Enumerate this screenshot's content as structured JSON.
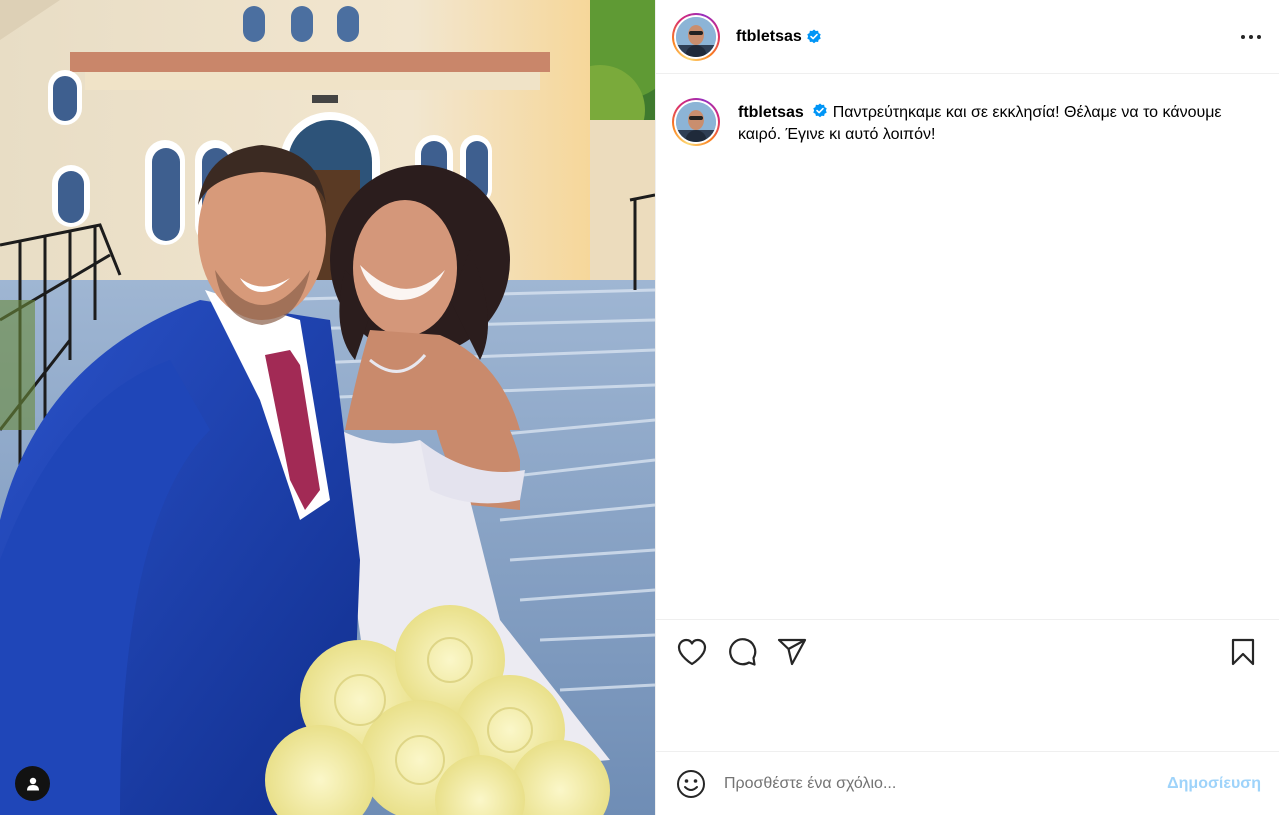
{
  "header": {
    "username": "ftbletsas"
  },
  "caption": {
    "username": "ftbletsas",
    "text": "Παντρεύτηκαμε και σε εκκλησία! Θέλαμε να το κάνουμε καιρό. Έγινε κι αυτό λοιπόν!"
  },
  "actions": {
    "like_icon": "heart-icon",
    "comment_icon": "comment-icon",
    "share_icon": "send-icon",
    "save_icon": "bookmark-icon"
  },
  "comment": {
    "placeholder": "Προσθέστε ένα σχόλιο...",
    "post_label": "Δημοσίευση"
  },
  "colors": {
    "verified": "#0095f6",
    "post_button": "#9ed3fa",
    "divider": "#efefef"
  }
}
